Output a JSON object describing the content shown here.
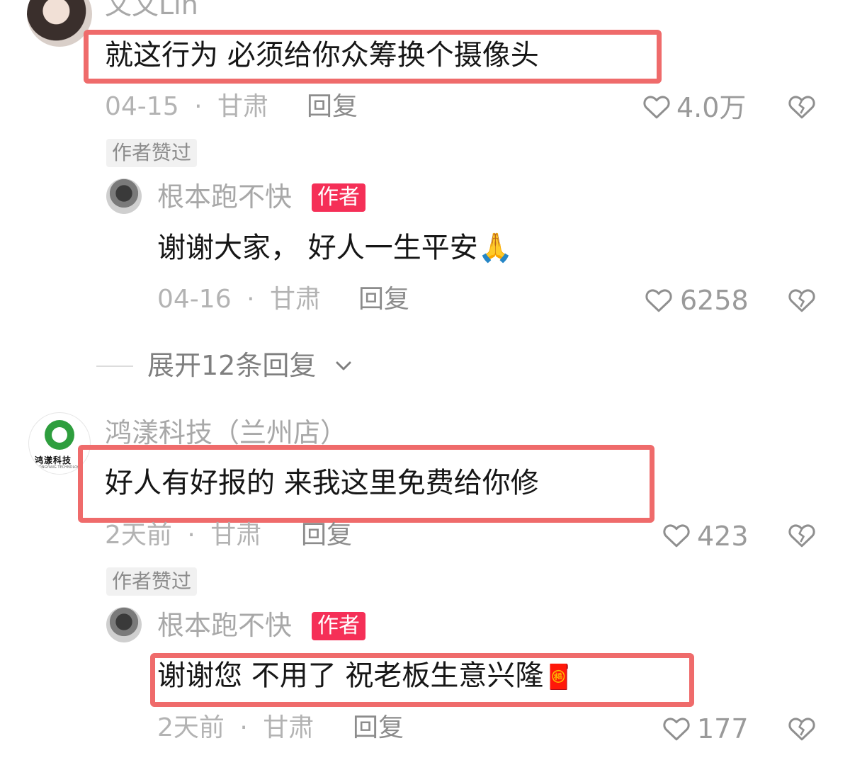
{
  "comments": [
    {
      "username": "文文Lin",
      "text": "就这行为 必须给你众筹换个摄像头",
      "date": "04-15",
      "location": "甘肃",
      "reply_label": "回复",
      "likes": "4.0万",
      "liked_by_author": "作者赞过",
      "author_reply": {
        "username": "根本跑不快",
        "badge": "作者",
        "text": "谢谢大家， 好人一生平安🙏",
        "date": "04-16",
        "location": "甘肃",
        "reply_label": "回复",
        "likes": "6258"
      },
      "expand_label": "展开12条回复"
    },
    {
      "username": "鸿漾科技（兰州店）",
      "avatar_text": "鸿漾科技",
      "avatar_subtext": "HONGYANG TECHNOLOGY",
      "text": "好人有好报的 来我这里免费给你修",
      "date": "2天前",
      "location": "甘肃",
      "reply_label": "回复",
      "likes": "423",
      "liked_by_author": "作者赞过",
      "author_reply": {
        "username": "根本跑不快",
        "badge": "作者",
        "text": "谢谢您 不用了  祝老板生意兴隆",
        "emoji": "🧧",
        "date": "2天前",
        "location": "甘肃",
        "reply_label": "回复",
        "likes": "177"
      }
    }
  ],
  "separator": "·",
  "icons": {
    "like": "heart-outline-icon",
    "dislike": "broken-heart-icon",
    "expand": "chevron-down-icon"
  },
  "colors": {
    "highlight_box": "#ef6b6b",
    "author_badge": "#f52f57",
    "logo_green": "#2e9e3e"
  }
}
